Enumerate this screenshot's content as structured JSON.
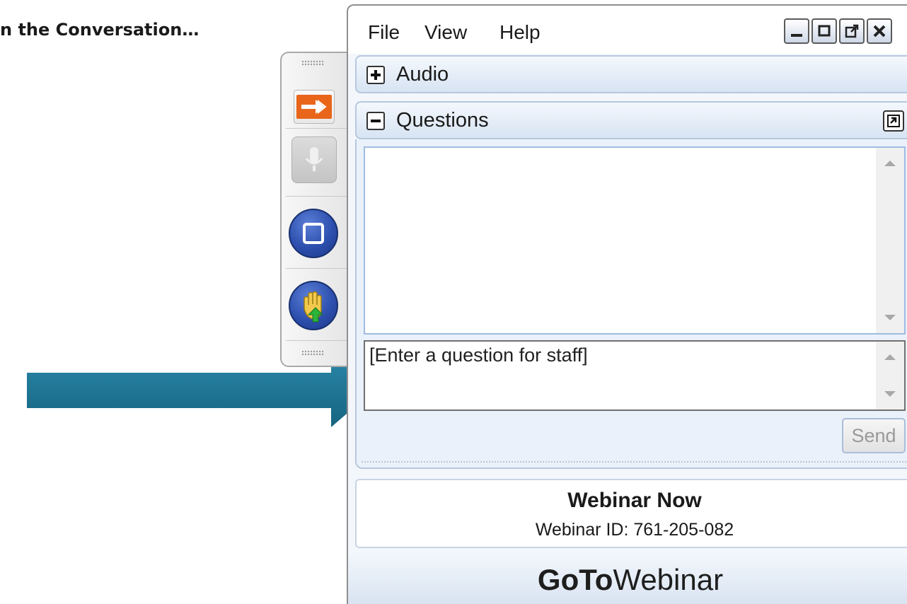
{
  "slide": {
    "heading_fragment": "n the Conversation…"
  },
  "menu": {
    "items": [
      "File",
      "View",
      "Help"
    ]
  },
  "window_controls": [
    "minimize-icon",
    "restore-icon",
    "popout-icon",
    "close-icon"
  ],
  "toolbar": {
    "buttons": [
      "show-panel-arrow-icon",
      "microphone-icon",
      "screen-icon",
      "raise-hand-icon"
    ]
  },
  "panels": {
    "audio": {
      "title": "Audio",
      "state": "collapsed"
    },
    "questions": {
      "title": "Questions",
      "state": "expanded",
      "input_placeholder": "[Enter a question for staff]",
      "send_label": "Send"
    }
  },
  "webinar": {
    "title": "Webinar Now",
    "id_text": "Webinar ID: 761-205-082"
  },
  "brand": {
    "bold": "GoTo",
    "light": "Webinar"
  },
  "colors": {
    "pointer_arrow": "#1e7392",
    "panel_border": "#b7c8de",
    "toolbar_button": "#2d4fae"
  }
}
